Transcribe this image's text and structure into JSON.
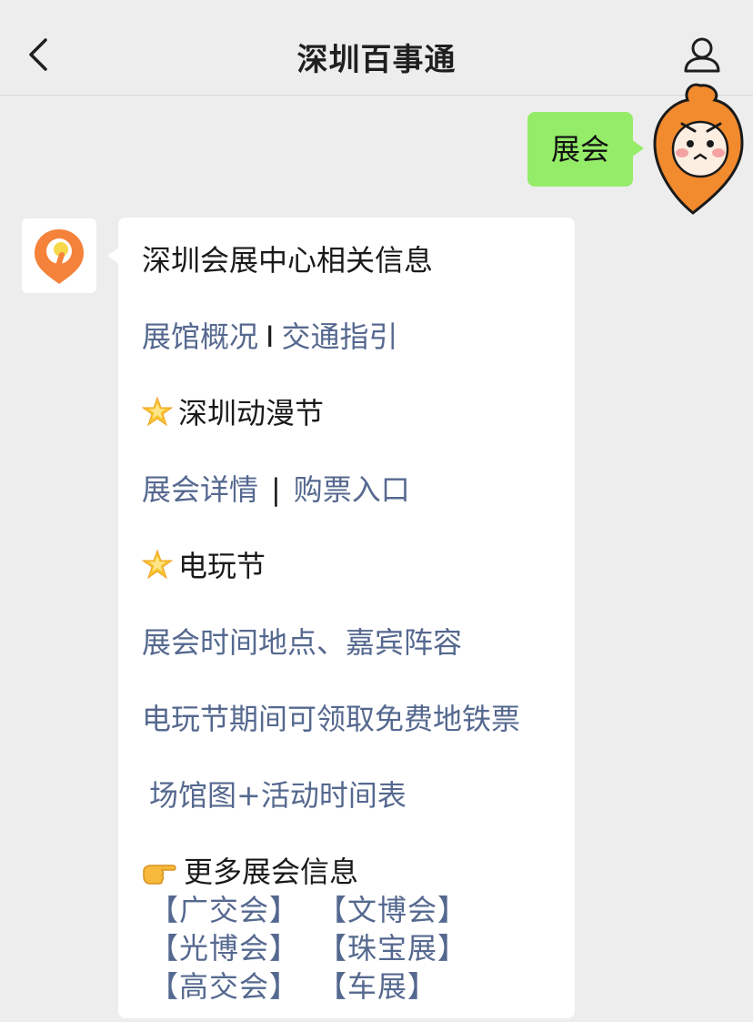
{
  "header": {
    "title": "深圳百事通"
  },
  "chat": {
    "outgoing_text": "展会",
    "incoming": {
      "heading": "深圳会展中心相关信息",
      "row1": {
        "a": "展馆概况",
        "sep": "I",
        "b": "交通指引"
      },
      "section1": {
        "emoji": "star-icon",
        "label": "深圳动漫节"
      },
      "row2": {
        "a": "展会详情",
        "sep": "|",
        "b": "购票入口"
      },
      "section2": {
        "emoji": "star-icon",
        "label": "电玩节"
      },
      "link_time": "展会时间地点、嘉宾阵容",
      "link_ticket": "电玩节期间可领取免费地铁票",
      "link_map": "场馆图+活动时间表",
      "section3": {
        "emoji": "pointing-hand-icon",
        "label": "更多展会信息"
      },
      "more": [
        [
          "【广交会】",
          "【文博会】"
        ],
        [
          "【光博会】",
          "【珠宝展】"
        ],
        [
          "【高交会】",
          "【车展】"
        ]
      ]
    }
  },
  "colors": {
    "background": "#ededed",
    "outgoing_bubble": "#95ec69",
    "link": "#55688f",
    "accent": "#f28a2e"
  }
}
